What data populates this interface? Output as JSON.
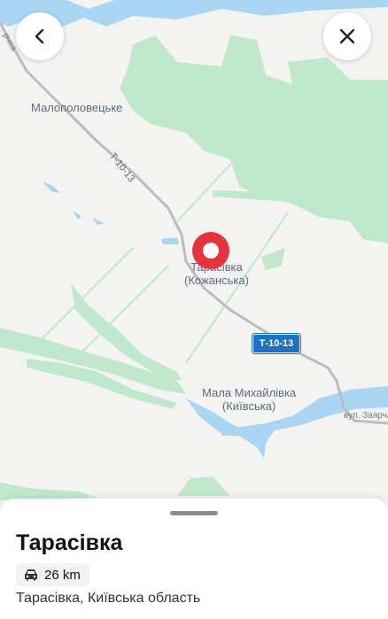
{
  "map": {
    "labels": {
      "malopolovetske": "Малополовецьке",
      "tarasivka_line1": "Тарасівка",
      "tarasivka_line2": "(Кожанська)",
      "mala_mykhailivka_line1": "Мала Михайлівка",
      "mala_mykhailivka_line2": "(Київська)",
      "road_code_diag": "Т-10-13",
      "street_fragment": "вул. Заярчан",
      "top_street_fragment": "рчна"
    },
    "road_badge": "Т-10-13",
    "colors": {
      "land": "#f3f3f1",
      "forest": "#bfe8cc",
      "water": "#a9d6f2",
      "road": "#bcbcbc",
      "pin": "#e8323c",
      "badge": "#1a73c9"
    }
  },
  "controls": {
    "back_icon": "chevron-left-icon",
    "close_icon": "close-icon"
  },
  "sheet": {
    "title": "Тарасівка",
    "distance": "26 km",
    "distance_icon": "car-icon",
    "subtitle": "Тарасівка, Київська область"
  }
}
